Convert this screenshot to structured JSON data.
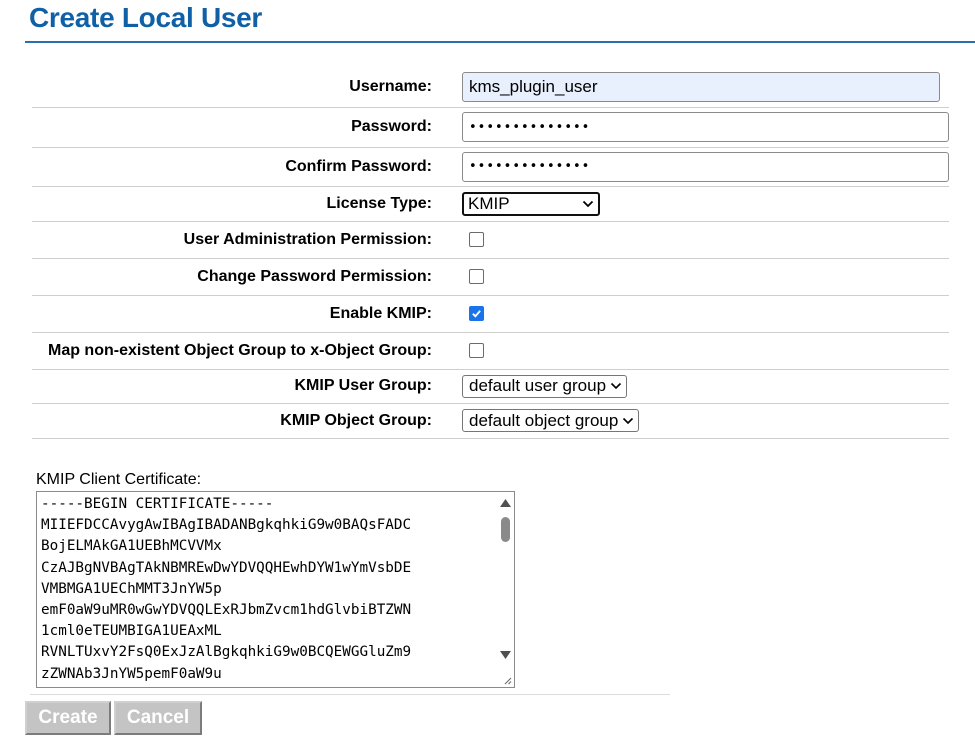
{
  "page": {
    "title": "Create Local User",
    "accent_color": "#1060a8"
  },
  "form": {
    "username": {
      "label": "Username:",
      "value": "kms_plugin_user"
    },
    "password": {
      "label": "Password:",
      "value": "••••••••••••••"
    },
    "confirm_password": {
      "label": "Confirm Password:",
      "value": "••••••••••••••"
    },
    "license_type": {
      "label": "License Type:",
      "selected": "KMIP"
    },
    "user_admin_permission": {
      "label": "User Administration Permission:",
      "checked": false
    },
    "change_password_permission": {
      "label": "Change Password Permission:",
      "checked": false
    },
    "enable_kmip": {
      "label": "Enable KMIP:",
      "checked": true
    },
    "map_object_group": {
      "label": "Map non-existent Object Group to x-Object Group:",
      "checked": false
    },
    "kmip_user_group": {
      "label": "KMIP User Group:",
      "selected": "default user group"
    },
    "kmip_object_group": {
      "label": "KMIP Object Group:",
      "selected": "default object group"
    }
  },
  "certificate": {
    "label": "KMIP Client Certificate:",
    "value": "-----BEGIN CERTIFICATE-----\nMIIEFDCCAvygAwIBAgIBADANBgkqhkiG9w0BAQsFADC\nBojELMAkGA1UEBhMCVVMx\nCzAJBgNVBAgTAkNBMREwDwYDVQQHEwhDYW1wYmVsbDE\nVMBMGA1UEChMMT3JnYW5p\nemF0aW9uMR0wGwYDVQQLExRJbmZvcm1hdGlvbiBTZWN\n1cml0eTEUMBIGA1UEAxML\nRVNLTUxvY2FsQ0ExJzAlBgkqhkiG9w0BCQEWGGluZm9\nzZWNAb3JnYW5pemF0aW9u"
  },
  "buttons": {
    "create": "Create",
    "cancel": "Cancel"
  },
  "icons": {
    "checkmark": "check-icon",
    "dropdown": "chevron-down-icon",
    "scroll_up": "triangle-up-icon",
    "scroll_down": "triangle-down-icon",
    "resize": "resize-grip-icon"
  }
}
